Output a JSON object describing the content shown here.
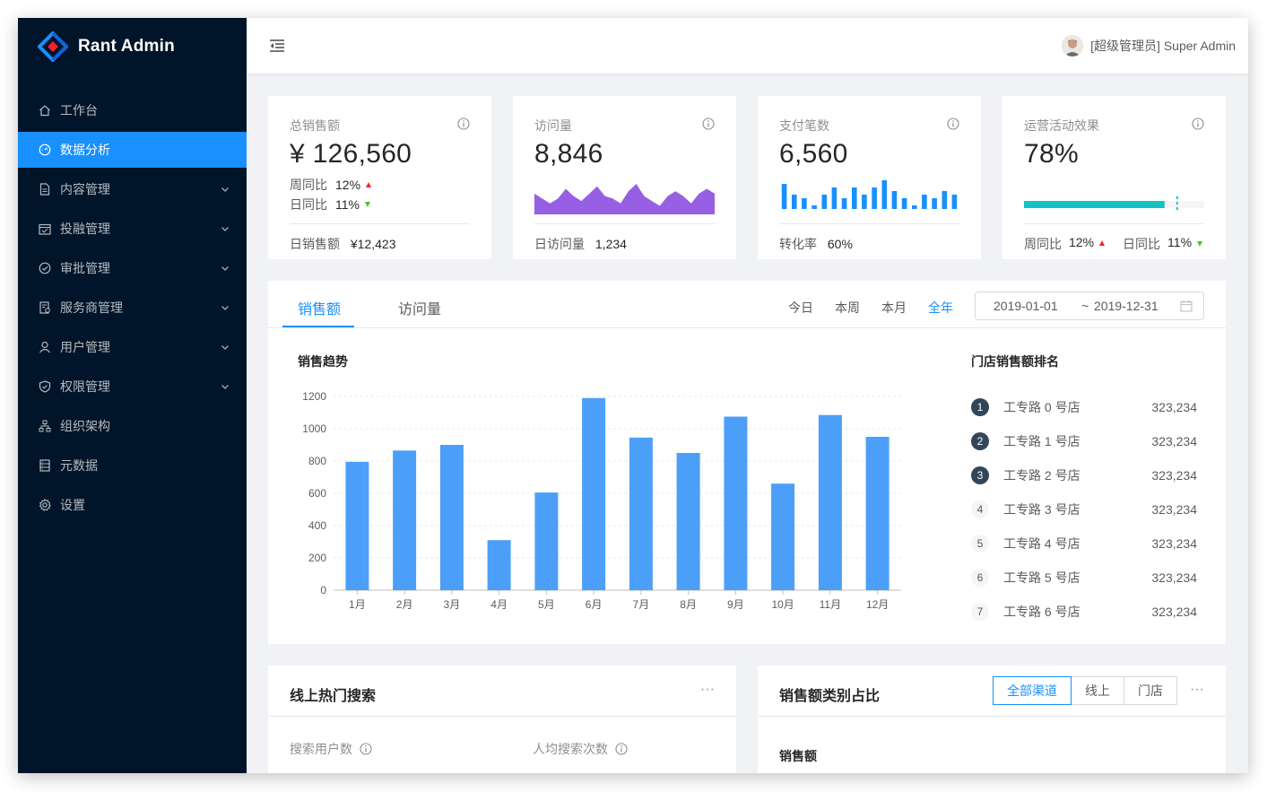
{
  "app": {
    "name": "Rant Admin"
  },
  "sidebar": {
    "items": [
      {
        "label": "工作台",
        "icon": "home-icon",
        "active": false,
        "has_children": false
      },
      {
        "label": "数据分析",
        "icon": "dashboard-icon",
        "active": true,
        "has_children": false
      },
      {
        "label": "内容管理",
        "icon": "file-icon",
        "active": false,
        "has_children": true
      },
      {
        "label": "投融管理",
        "icon": "calendar-icon",
        "active": false,
        "has_children": true
      },
      {
        "label": "审批管理",
        "icon": "check-circle-icon",
        "active": false,
        "has_children": true
      },
      {
        "label": "服务商管理",
        "icon": "audit-icon",
        "active": false,
        "has_children": true
      },
      {
        "label": "用户管理",
        "icon": "user-icon",
        "active": false,
        "has_children": true
      },
      {
        "label": "权限管理",
        "icon": "shield-icon",
        "active": false,
        "has_children": true
      },
      {
        "label": "组织架构",
        "icon": "cluster-icon",
        "active": false,
        "has_children": false
      },
      {
        "label": "元数据",
        "icon": "database-icon",
        "active": false,
        "has_children": false
      },
      {
        "label": "设置",
        "icon": "gear-icon",
        "active": false,
        "has_children": false
      }
    ]
  },
  "header": {
    "user": "[超级管理员] Super Admin"
  },
  "stats": {
    "sales": {
      "title": "总销售额",
      "value": "¥ 126,560",
      "wow_label": "周同比",
      "wow_value": "12%",
      "dod_label": "日同比",
      "dod_value": "11%",
      "footer_label": "日销售额",
      "footer_value": "¥12,423"
    },
    "visits": {
      "title": "访问量",
      "value": "8,846",
      "footer_label": "日访问量",
      "footer_value": "1,234",
      "area_color": "#975fe4",
      "sparkline": [
        7,
        5,
        3,
        5,
        9,
        6,
        4,
        7,
        10,
        6,
        5,
        3,
        8,
        11,
        6,
        4,
        2,
        6,
        8,
        6,
        3,
        7,
        9,
        7
      ]
    },
    "payments": {
      "title": "支付笔数",
      "value": "6,560",
      "footer_label": "转化率",
      "footer_value": "60%",
      "bar_color": "#1890ff",
      "mini_bars": [
        7,
        4,
        3,
        1,
        4,
        6,
        3,
        6,
        4,
        6,
        8,
        5,
        3,
        1,
        4,
        3,
        5,
        4
      ]
    },
    "operations": {
      "title": "运营活动效果",
      "value": "78%",
      "progress": 0.78,
      "target": 0.85,
      "progress_color": "#13c2c2",
      "wow_label": "周同比",
      "wow_value": "12%",
      "dod_label": "日同比",
      "dod_value": "11%"
    }
  },
  "sales_card": {
    "tabs": [
      "销售额",
      "访问量"
    ],
    "active_tab": 0,
    "ranges": [
      "今日",
      "本周",
      "本月",
      "全年"
    ],
    "active_range": 3,
    "date_start": "2019-01-01",
    "date_sep": "~",
    "date_end": "2019-12-31",
    "chart_title": "销售趋势",
    "ranking_title": "门店销售额排名",
    "ranking": [
      {
        "rank": "1",
        "name": "工专路 0 号店",
        "value": "323,234"
      },
      {
        "rank": "2",
        "name": "工专路 1 号店",
        "value": "323,234"
      },
      {
        "rank": "3",
        "name": "工专路 2 号店",
        "value": "323,234"
      },
      {
        "rank": "4",
        "name": "工专路 3 号店",
        "value": "323,234"
      },
      {
        "rank": "5",
        "name": "工专路 4 号店",
        "value": "323,234"
      },
      {
        "rank": "6",
        "name": "工专路 5 号店",
        "value": "323,234"
      },
      {
        "rank": "7",
        "name": "工专路 6 号店",
        "value": "323,234"
      }
    ]
  },
  "chart_data": {
    "type": "bar",
    "title": "销售趋势",
    "categories": [
      "1月",
      "2月",
      "3月",
      "4月",
      "5月",
      "6月",
      "7月",
      "8月",
      "9月",
      "10月",
      "11月",
      "12月"
    ],
    "values": [
      795,
      865,
      900,
      310,
      605,
      1190,
      945,
      850,
      1075,
      660,
      1085,
      950
    ],
    "ylim": [
      0,
      1200
    ],
    "yticks": [
      0,
      200,
      400,
      600,
      800,
      1000,
      1200
    ],
    "grid": true,
    "bar_color": "#4c9ff8"
  },
  "hot_search": {
    "title": "线上热门搜索",
    "more": "···",
    "users_label": "搜索用户数",
    "per_user_label": "人均搜索次数"
  },
  "category": {
    "title": "销售额类别占比",
    "buttons": [
      "全部渠道",
      "线上",
      "门店"
    ],
    "active_button": 0,
    "more": "···",
    "subtitle": "销售额"
  }
}
